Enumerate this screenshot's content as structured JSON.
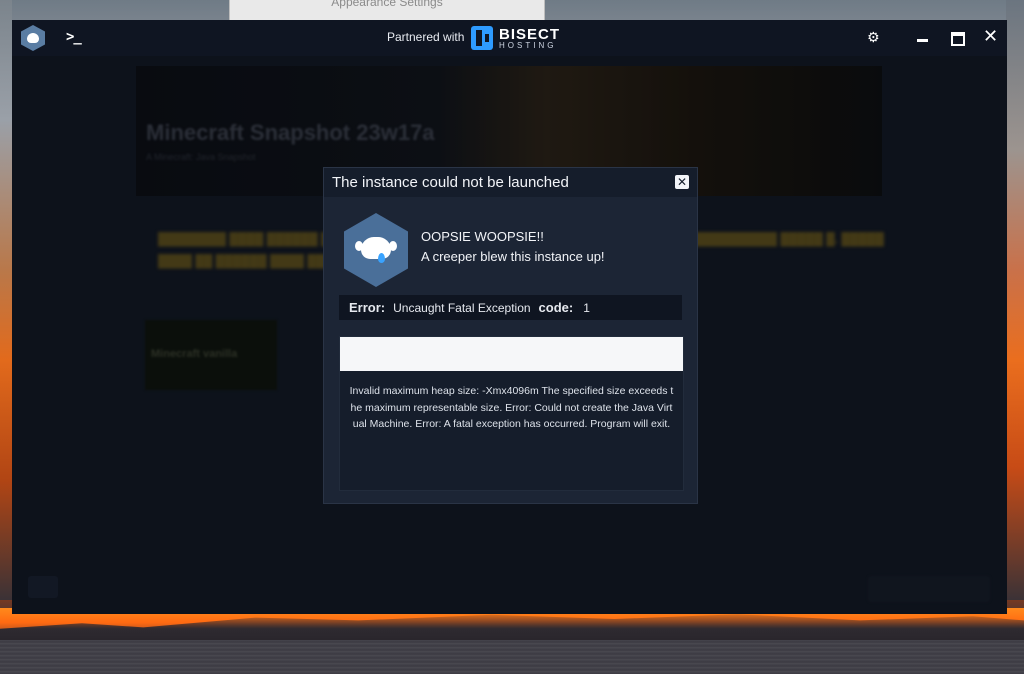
{
  "background_window": {
    "title": "Appearance Settings"
  },
  "titlebar": {
    "terminal_glyph": ">_",
    "partner_label": "Partnered with",
    "bisect_brand": "BISECT",
    "bisect_sub": "HOSTING",
    "icons": [
      "app-logo-icon",
      "terminal-icon",
      "gear-icon",
      "minimize-icon",
      "maximize-icon",
      "close-icon"
    ]
  },
  "background_content": {
    "instance_title": "Minecraft Snapshot 23w17a",
    "instance_sub": "A Minecraft: Java Snapshot",
    "tile_label": "Minecraft vanilla"
  },
  "dialog": {
    "title": "The instance could not be launched",
    "close_glyph": "✕",
    "heading": "OOPSIE WOOPSIE!!",
    "subheading": "A creeper blew this instance up!",
    "error_label": "Error:",
    "error_value": "Uncaught Fatal Exception",
    "code_label": "code:",
    "code_value": "1",
    "log_text": "Invalid maximum heap size: -Xmx4096m The specified size exceeds the maximum representable size. Error: Could not create the Java Virtual Machine. Error: A fatal exception has occurred. Program will exit."
  },
  "colors": {
    "app_bg": "#111723",
    "dialog_bg": "#1c2535",
    "accent_blue": "#2e9bff",
    "avatar_hex": "#4a6f99"
  }
}
